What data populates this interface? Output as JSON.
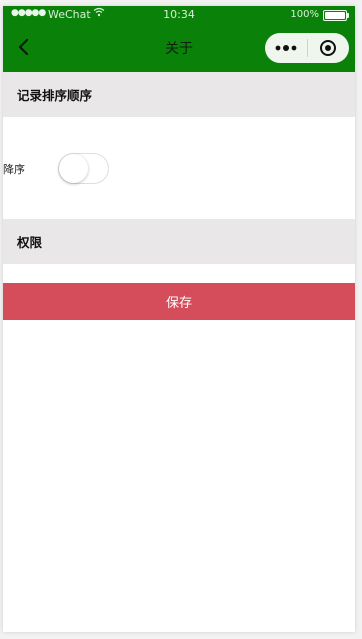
{
  "statusbar": {
    "signal": "●●●●●",
    "carrier": "WeChat",
    "wifi_icon": "wifi-icon",
    "time": "10:34",
    "battery_pct": "100%"
  },
  "navbar": {
    "title": "关于",
    "back_icon": "chevron-left-icon",
    "more_icon": "more-dots-icon",
    "close_icon": "target-close-icon",
    "bg_color": "#0a820a"
  },
  "sections": {
    "sort_title": "记录排序顺序",
    "permission_title": "权限"
  },
  "sort_setting": {
    "label": "降序",
    "toggle_on": false
  },
  "actions": {
    "save_label": "保存",
    "save_color": "#d54c5a"
  }
}
